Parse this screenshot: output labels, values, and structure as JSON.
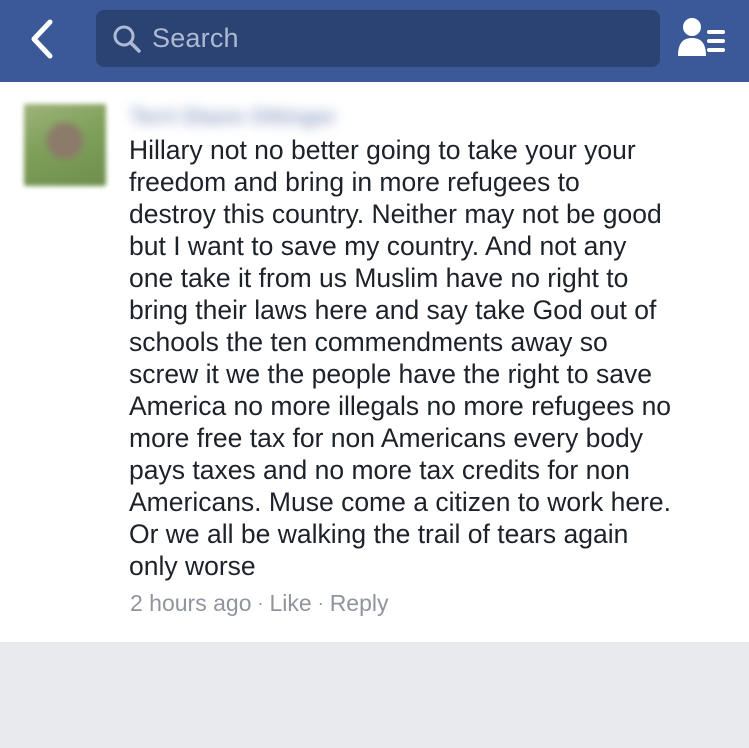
{
  "header": {
    "search_placeholder": "Search",
    "background_color": "#3b5998",
    "icons": {
      "back": "chevron-left-icon",
      "search": "search-icon",
      "friends": "friend-requests-icon"
    }
  },
  "comment": {
    "author": "Terri Diann Ottinger",
    "text": "Hillary not no better going to take your your\nfreedom and bring in more refugees to\ndestroy this country. Neither may not be good\nbut I want to save my country. And not any\none take it from us Muslim have no right to\nbring their laws here and say take God out of\nschools the ten commendments away so\nscrew it we the people have the right to save\nAmerica no more illegals no more refugees no\nmore free tax for non Americans every body\npays taxes and no more tax credits for non\nAmericans. Muse come a citizen to work here.\nOr we all be walking the trail of tears again\nonly worse",
    "timestamp": "2 hours ago",
    "separator": "·",
    "like_label": "Like",
    "reply_label": "Reply"
  }
}
